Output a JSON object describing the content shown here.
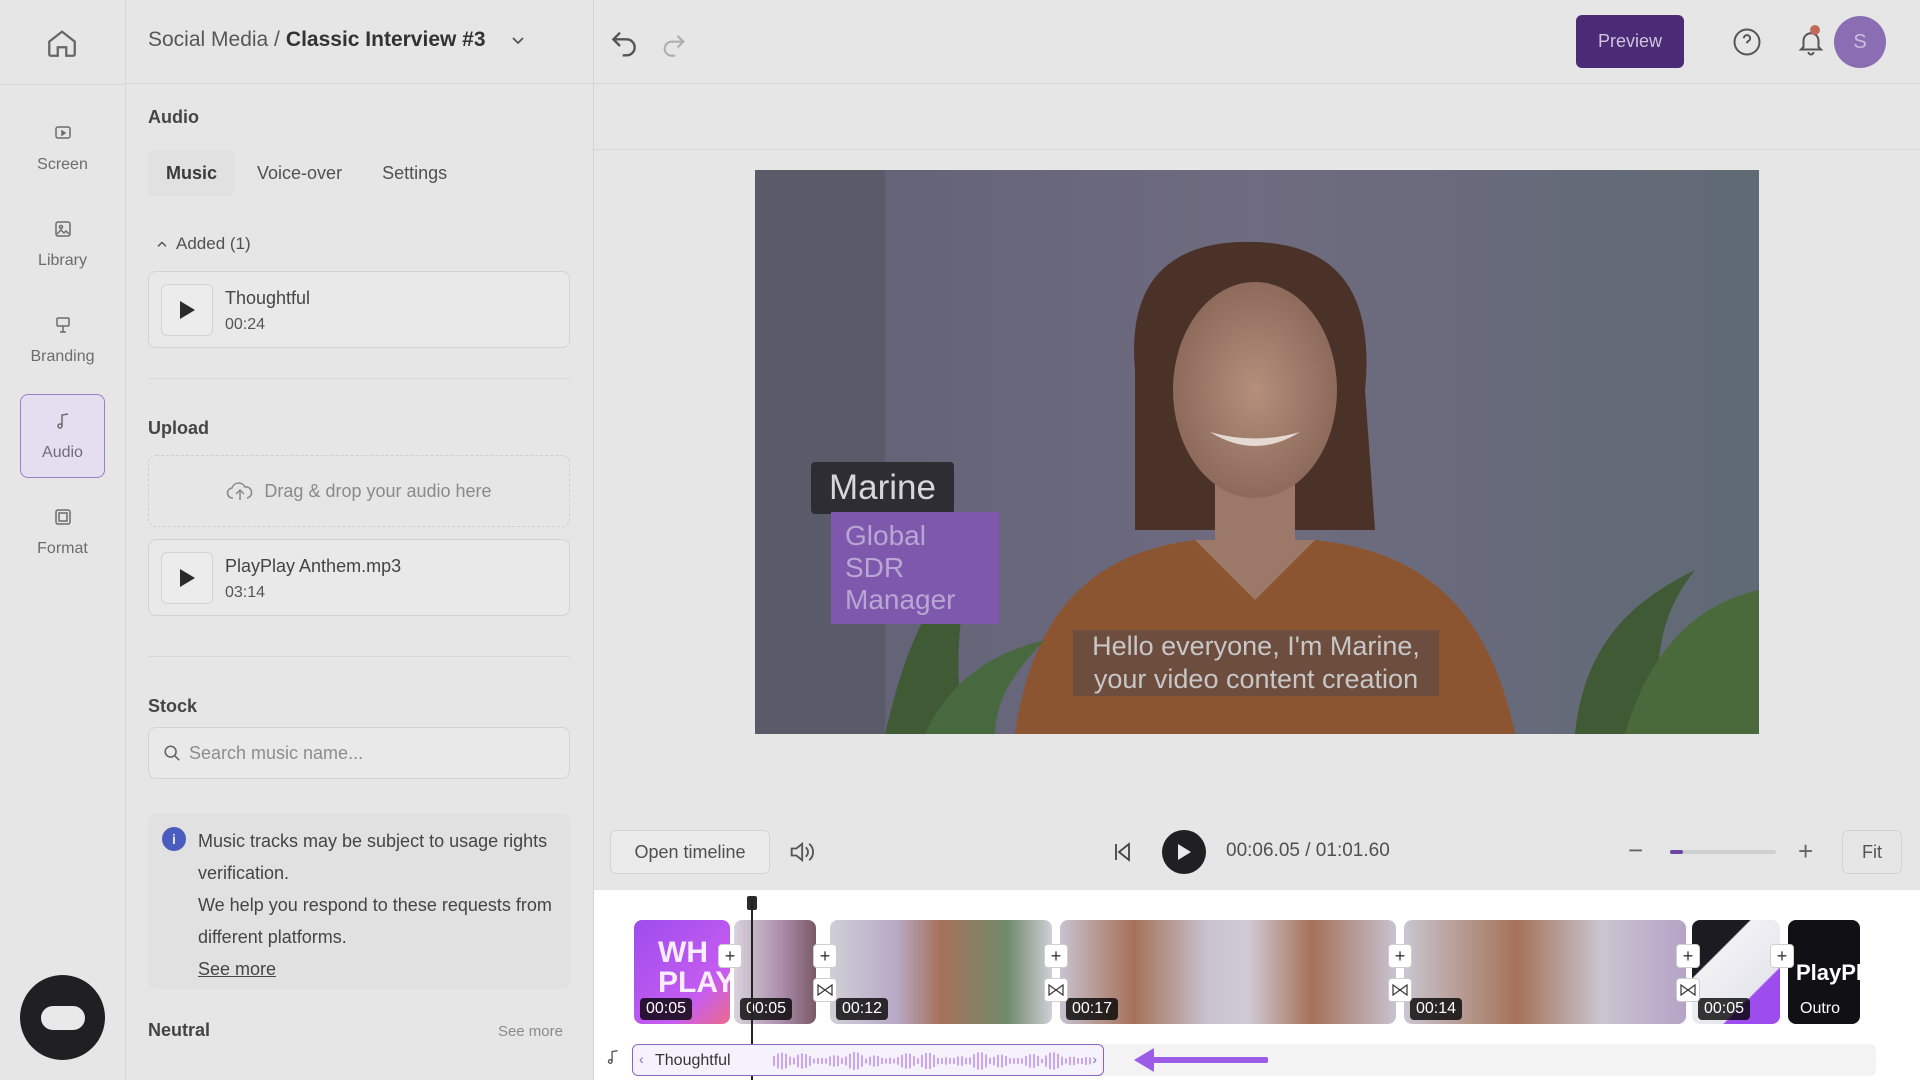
{
  "header": {
    "breadcrumb_parent": "Social Media /",
    "breadcrumb_current": "Classic Interview #3",
    "preview_label": "Preview",
    "avatar_initial": "S"
  },
  "rail": {
    "items": [
      {
        "label": "Screen",
        "icon": "screen-icon"
      },
      {
        "label": "Library",
        "icon": "library-icon"
      },
      {
        "label": "Branding",
        "icon": "branding-icon"
      },
      {
        "label": "Audio",
        "icon": "music-note-icon",
        "active": true
      },
      {
        "label": "Format",
        "icon": "format-icon"
      }
    ]
  },
  "panel": {
    "audio_title": "Audio",
    "tabs": [
      {
        "label": "Music",
        "active": true
      },
      {
        "label": "Voice-over"
      },
      {
        "label": "Settings"
      }
    ],
    "added_header": "Added (1)",
    "added_track": {
      "name": "Thoughtful",
      "duration": "00:24"
    },
    "upload_title": "Upload",
    "dropzone_text": "Drag & drop your audio here",
    "uploaded_track": {
      "name": "PlayPlay Anthem.mp3",
      "duration": "03:14"
    },
    "stock_title": "Stock",
    "search_placeholder": "Search music name...",
    "notice": {
      "line1": "Music tracks may be subject to usage rights verification.",
      "line2": "We help you respond to these requests from different platforms.",
      "link": "See more"
    },
    "neutral_title": "Neutral",
    "neutral_see_more": "See more"
  },
  "video": {
    "name": "Marine",
    "role": "Global SDR Manager",
    "subtitle": "Hello everyone, I'm Marine, your video content creation"
  },
  "controls": {
    "open_timeline": "Open timeline",
    "current_time": "00:06.05",
    "total_time": "/ 01:01.60",
    "fit_label": "Fit",
    "zoom_fraction": 0.12
  },
  "timeline": {
    "clips": [
      {
        "duration": "00:05",
        "label": "WH PLAY"
      },
      {
        "duration": "00:05"
      },
      {
        "duration": "00:12"
      },
      {
        "duration": "00:17"
      },
      {
        "duration": "00:14"
      },
      {
        "duration": "00:05"
      },
      {
        "duration": "Outro",
        "label": "PlayPl"
      }
    ],
    "audio_track": "Thoughtful"
  },
  "colors": {
    "accent": "#6b45a6",
    "preview_bg": "#4b2a76",
    "tag_purple": "#7e58ac"
  }
}
